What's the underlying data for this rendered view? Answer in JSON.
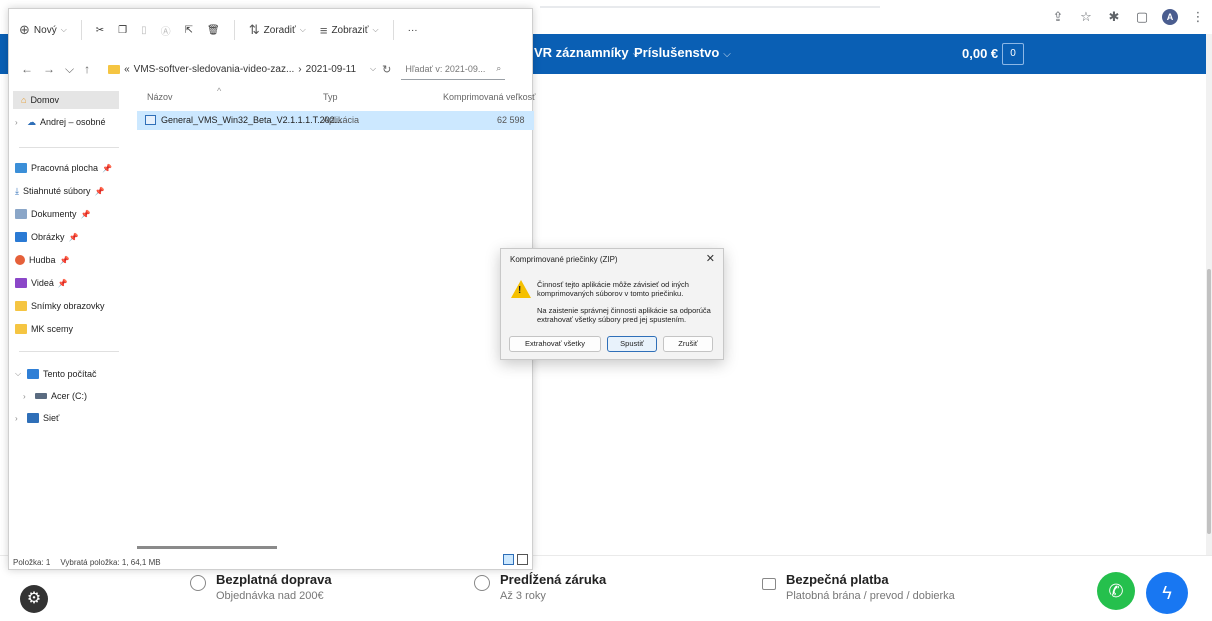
{
  "browser": {
    "avatar_letter": "A",
    "icons": [
      "share-icon",
      "star-icon",
      "extensions-icon",
      "sidebar-icon",
      "menu-icon"
    ]
  },
  "site": {
    "nav": [
      {
        "label": "VR záznamníky"
      },
      {
        "label": "Príslušenstvo"
      }
    ],
    "cart_price": "0,00 €",
    "cart_count": "0",
    "footer": [
      {
        "title": "Bezplatná doprava",
        "subtitle": "Objednávka nad 200€",
        "icon": "location-icon"
      },
      {
        "title": "Predĺžená záruka",
        "subtitle": "Až 3 roky",
        "icon": "shield-icon"
      },
      {
        "title": "Bezpečná platba",
        "subtitle": "Platobná brána / prevod / dobierka",
        "icon": "lock-icon"
      }
    ],
    "colors": {
      "nav": "#0a5fb4",
      "whatsapp": "#25c04d",
      "messenger": "#1877f2"
    }
  },
  "explorer": {
    "toolbar": {
      "new": "Nový",
      "sort": "Zoradiť",
      "view": "Zobraziť",
      "more": "···"
    },
    "address": {
      "path_prefix": "«",
      "path_folder": "VMS-softver-sledovania-video-zaz...",
      "path_sep": "›",
      "path_current": "2021-09-11",
      "search_placeholder": "Hľadať v: 2021-09..."
    },
    "nav_pane": {
      "home": "Domov",
      "cloud": "Andrej – osobné",
      "quick": [
        {
          "label": "Pracovná plocha",
          "color": "#3b8fd8"
        },
        {
          "label": "Stiahnuté súbory",
          "color": "#2f6fb8"
        },
        {
          "label": "Dokumenty",
          "color": "#8aa6c8"
        },
        {
          "label": "Obrázky",
          "color": "#2a7ad4"
        },
        {
          "label": "Hudba",
          "color": "#e5603a"
        },
        {
          "label": "Videá",
          "color": "#8b47c8"
        },
        {
          "label": "Snímky obrazovky",
          "color": "#f5c542"
        },
        {
          "label": "MK scemy",
          "color": "#f5c542"
        }
      ],
      "this_pc": "Tento počítač",
      "drive": "Acer (C:)",
      "network": "Sieť"
    },
    "columns": [
      "Názov",
      "Typ",
      "Komprimovaná veľkosť"
    ],
    "files": [
      {
        "name": "General_VMS_Win32_Beta_V2.1.1.1.T.202...",
        "type": "Aplikácia",
        "size": "62 598"
      }
    ],
    "status": {
      "items": "Položka: 1",
      "selected": "Vybratá položka: 1, 64,1 MB"
    }
  },
  "dialog": {
    "title": "Komprimované priečinky (ZIP)",
    "message1": "Činnosť tejto aplikácie môže závisieť od iných komprimovaných súborov v tomto priečinku.",
    "message2": "Na zaistenie správnej činnosti aplikácie sa odporúča extrahovať všetky súbory pred jej spustením.",
    "buttons": {
      "extract": "Extrahovať všetky",
      "run": "Spustiť",
      "cancel": "Zrušiť"
    }
  }
}
